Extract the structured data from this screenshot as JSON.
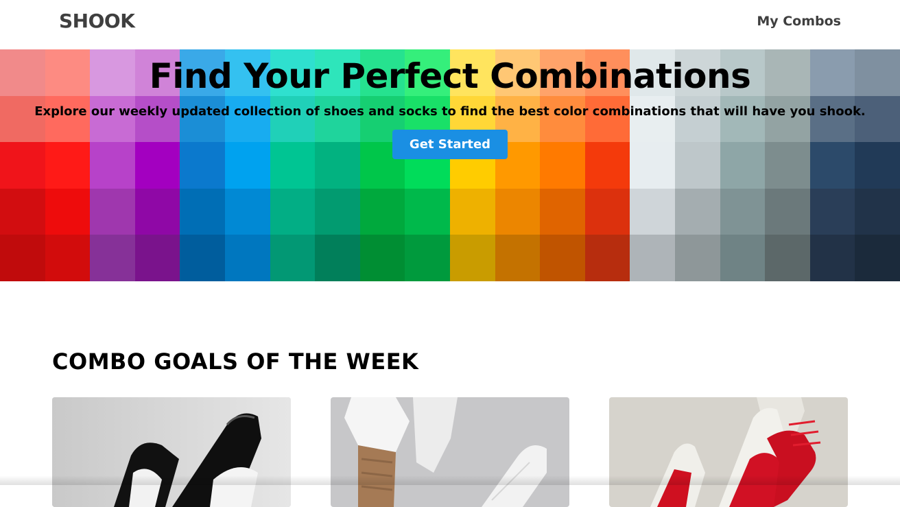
{
  "nav": {
    "logo": "SHOOK",
    "link": "My Combos"
  },
  "hero": {
    "title": "Find Your Perfect Combinations",
    "subtitle": "Explore our weekly updated collection of shoes and socks to find the best color combinations that will have you shook.",
    "cta": "Get Started",
    "palette": [
      [
        "#f18a8a",
        "#f06a62",
        "#f0141a",
        "#d20d10",
        "#c00b0c"
      ],
      [
        "#fd8b82",
        "#ff6a5e",
        "#ff1a17",
        "#ee0c0c",
        "#d20c0c"
      ],
      [
        "#d898e0",
        "#c86bd4",
        "#b742c9",
        "#9f37ae",
        "#863198"
      ],
      [
        "#d083d8",
        "#b54ec8",
        "#a300c0",
        "#8f08a6",
        "#7a138c"
      ],
      [
        "#3aa9e8",
        "#1b8ed6",
        "#0b79cd",
        "#006eb5",
        "#005d9d"
      ],
      [
        "#34c1f0",
        "#18acf0",
        "#00a2ef",
        "#0189d4",
        "#0077bf"
      ],
      [
        "#2fe0cf",
        "#20d0b8",
        "#00c593",
        "#02ae85",
        "#029874"
      ],
      [
        "#2ee5bb",
        "#1fd49c",
        "#02b280",
        "#029b70",
        "#017f5a"
      ],
      [
        "#26e28f",
        "#16cf72",
        "#00c64a",
        "#00a93d",
        "#008e33"
      ],
      [
        "#35ef7b",
        "#19e068",
        "#01dc5a",
        "#00b94b",
        "#009a3d"
      ],
      [
        "#ffe45e",
        "#ffd737",
        "#ffcc00",
        "#eeb100",
        "#c99c00"
      ],
      [
        "#ffc774",
        "#ffb245",
        "#ff9900",
        "#ec8600",
        "#c47200"
      ],
      [
        "#ffa36a",
        "#ff8c3d",
        "#ff7a00",
        "#e06400",
        "#c05400"
      ],
      [
        "#ff8f5c",
        "#ff6b37",
        "#f43a0b",
        "#dc310d",
        "#b72d0e"
      ],
      [
        "#e0e8ea",
        "#e8eef0",
        "#e7edf0",
        "#cfd5d9",
        "#aeb4b8"
      ],
      [
        "#cdd6d8",
        "#c5cfd2",
        "#bec7ca",
        "#a4adb0",
        "#8e9799"
      ],
      [
        "#b8c8c9",
        "#a2b8b8",
        "#8ea6a7",
        "#7f9395",
        "#6f8385"
      ],
      [
        "#a9b6b6",
        "#93a3a3",
        "#7d8d8e",
        "#6b797b",
        "#5c6869"
      ],
      [
        "#8a9cae",
        "#5a6f86",
        "#2c4a6a",
        "#2a3e58",
        "#223247"
      ],
      [
        "#7f90a0",
        "#4c6079",
        "#213a57",
        "#213349",
        "#1b2a3b"
      ]
    ]
  },
  "section": {
    "title": "COMBO GOALS OF THE WEEK"
  },
  "cards": [
    {
      "name": "Black and white sneakers",
      "bg": "#d8d8d8"
    },
    {
      "name": "White sneakers with brown socks",
      "bg": "#c7c7c9"
    },
    {
      "name": "Red and white high-top sneakers",
      "bg": "#d6d3cc"
    }
  ]
}
